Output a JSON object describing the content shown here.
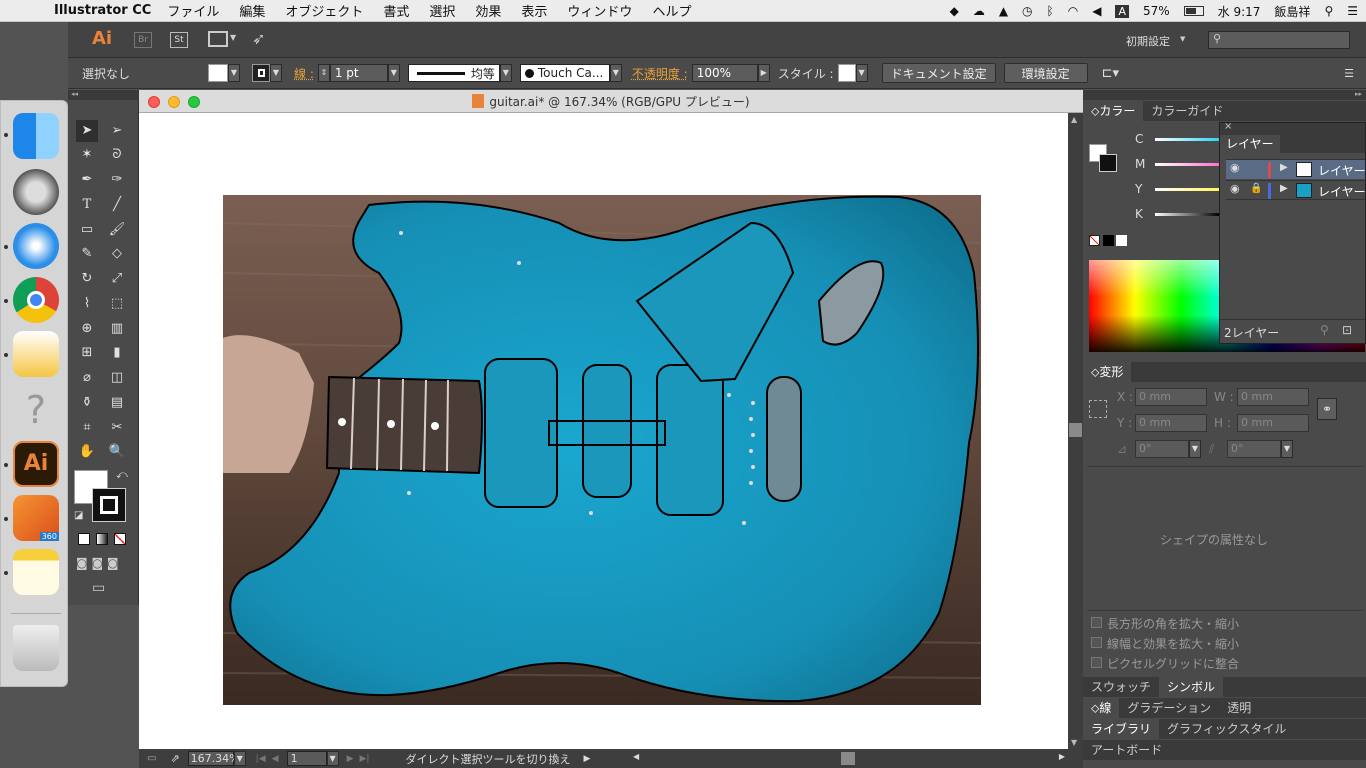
{
  "menubar": {
    "app_name": "Illustrator CC",
    "items": [
      "ファイル",
      "編集",
      "オブジェクト",
      "書式",
      "選択",
      "効果",
      "表示",
      "ウィンドウ",
      "ヘルプ"
    ],
    "battery": "57%",
    "clock": "水 9:17",
    "user": "飯島祥"
  },
  "appbar": {
    "logo": "Ai",
    "br": "Br",
    "st": "St",
    "workspace": "初期設定",
    "search_placeholder": ""
  },
  "control": {
    "selection": "選択なし",
    "stroke_label": "線 :",
    "stroke_width": "1 pt",
    "profile": "均等",
    "brush": "Touch Ca...",
    "opacity_label": "不透明度 :",
    "opacity": "100%",
    "style_label": "スタイル :",
    "doc_setup": "ドキュメント設定",
    "preferences": "環境設定"
  },
  "document": {
    "title": "guitar.ai* @ 167.34% (RGB/GPU プレビュー)"
  },
  "status": {
    "zoom": "167.34%",
    "artboard": "1",
    "message": "ダイレクト選択ツールを切り換え"
  },
  "color_panel": {
    "tab_color": "カラー",
    "tab_guide": "カラーガイド",
    "channels": [
      "C",
      "M",
      "Y",
      "K"
    ]
  },
  "layers_panel": {
    "title": "レイヤー",
    "rows": [
      "レイヤー",
      "レイヤー"
    ],
    "footer": "2レイヤー"
  },
  "transform_panel": {
    "title": "変形",
    "x_label": "X :",
    "x_value": "0 mm",
    "y_label": "Y :",
    "y_value": "0 mm",
    "w_label": "W :",
    "w_value": "0 mm",
    "h_label": "H :",
    "h_value": "0 mm",
    "angle_value": "0°",
    "shear_value": "0°",
    "no_shape": "シェイプの属性なし",
    "opt1": "長方形の角を拡大・縮小",
    "opt2": "線幅と効果を拡大・縮小",
    "opt3": "ピクセルグリッドに整合"
  },
  "bottom_tabs": {
    "swatch": "スウォッチ",
    "symbol": "シンボル",
    "stroke": "線",
    "gradient": "グラデーション",
    "transparency": "透明",
    "library": "ライブラリ",
    "graphic_style": "グラフィックスタイル",
    "artboard": "アートボード"
  },
  "colors": {
    "guitar_body": "#1a9fc4",
    "ui_dark": "#4a4a4a",
    "accent_orange": "#e8a13a"
  }
}
